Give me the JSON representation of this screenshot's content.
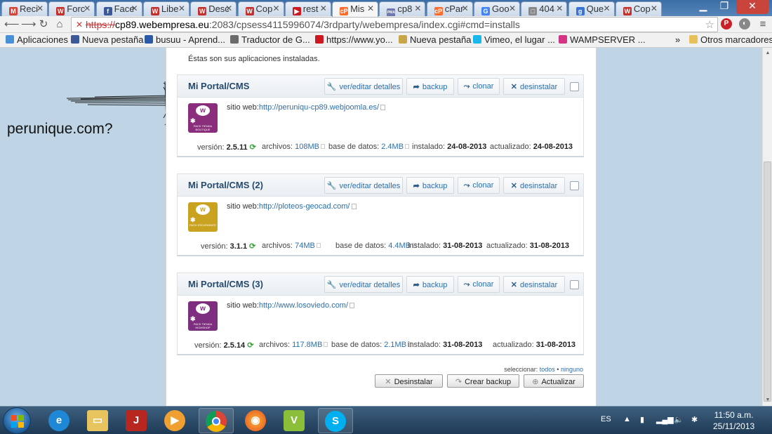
{
  "browser": {
    "tabs": [
      {
        "label": "Reci",
        "fav": "M",
        "color": "#d44638"
      },
      {
        "label": "Forc",
        "fav": "W",
        "color": "#c4302b"
      },
      {
        "label": "Face",
        "fav": "f",
        "color": "#3b5998"
      },
      {
        "label": "Libe",
        "fav": "W",
        "color": "#c4302b"
      },
      {
        "label": "Desc",
        "fav": "W",
        "color": "#c4302b"
      },
      {
        "label": "Cop",
        "fav": "W",
        "color": "#c4302b"
      },
      {
        "label": "rest",
        "fav": "▶",
        "color": "#cc181e"
      },
      {
        "label": "Mis",
        "fav": "cP",
        "color": "#ff6c2c",
        "active": true
      },
      {
        "label": "cp8",
        "fav": "PMA",
        "color": "#6c78af"
      },
      {
        "label": "cPar",
        "fav": "cP",
        "color": "#ff6c2c"
      },
      {
        "label": "Goo",
        "fav": "G",
        "color": "#4285f4"
      },
      {
        "label": "404",
        "fav": "□",
        "color": "#888888"
      },
      {
        "label": "Que",
        "fav": "g",
        "color": "#3a73d6"
      },
      {
        "label": "Cop",
        "fav": "W",
        "color": "#c4302b"
      }
    ],
    "url_prefix": "https://",
    "url_host": "cp89.webempresa.eu",
    "url_rest": ":2083/cpsess4115996074/3rdparty/webempresa/index.cgi#cmd=installs",
    "bookmarks": [
      {
        "label": "Aplicaciones",
        "color": "#4a90d9"
      },
      {
        "label": "Nueva pestaña",
        "color": "#3b5998"
      },
      {
        "label": "busuu - Aprend...",
        "color": "#2b5aa8"
      },
      {
        "label": "Traductor de G...",
        "color": "#6b6b6b"
      },
      {
        "label": "https://www.yo...",
        "color": "#cc181e"
      },
      {
        "label": "Nueva pestaña",
        "color": "#c9a54a"
      },
      {
        "label": "Vimeo, el lugar ...",
        "color": "#1ab7ea"
      },
      {
        "label": "WAMPSERVER ...",
        "color": "#d63384"
      }
    ],
    "bookmarks_more": "»",
    "other_bookmarks": "Otros marcadores"
  },
  "page": {
    "intro": "Éstas son sus aplicaciones instaladas.",
    "buttons": {
      "details": "ver/editar detalles",
      "backup": "backup",
      "clone": "clonar",
      "uninstall": "desinstalar"
    },
    "labels": {
      "site": "sitio web:",
      "version": "versión:",
      "files": "archivos:",
      "db": "base de datos:",
      "installed": "instalado:",
      "updated": "actualizado:"
    },
    "apps": [
      {
        "title": "Mi Portal/CMS",
        "url": "http://peruniqu-cp89.webjoomla.es/",
        "version": "2.5.11",
        "files": "108MB",
        "db": "2.4MB",
        "installed": "24-08-2013",
        "updated": "24-08-2013",
        "thumb_color": "#8a2e7c",
        "thumb_text": "PACK TIENDA BOUTIQUE"
      },
      {
        "title": "Mi Portal/CMS (2)",
        "url": "http://ploteos-geocad.com/",
        "version": "3.1.1",
        "files": "74MB",
        "db": "4.4MB",
        "installed": "31-08-2013",
        "updated": "31-08-2013",
        "thumb_color": "#c9a21f",
        "thumb_text": "PACK ESCAPARATE"
      },
      {
        "title": "Mi Portal/CMS (3)",
        "url": "http://www.losoviedo.com/",
        "version": "2.5.14",
        "files": "117.8MB",
        "db": "2.1MB",
        "installed": "31-08-2013",
        "updated": "31-08-2013",
        "thumb_color": "#7d2e7e",
        "thumb_text": "PACK TIENDA HIGHSHOP"
      }
    ],
    "select_label": "seleccionar:",
    "select_all": "todos",
    "select_none": "ninguno",
    "bottom_buttons": {
      "uninstall": "Desinstalar",
      "backup": "Crear backup",
      "update": "Actualizar"
    },
    "side_note": "perunique.com?"
  },
  "taskbar": {
    "lang": "ES",
    "time": "11:50 a.m.",
    "date": "25/11/2013"
  }
}
